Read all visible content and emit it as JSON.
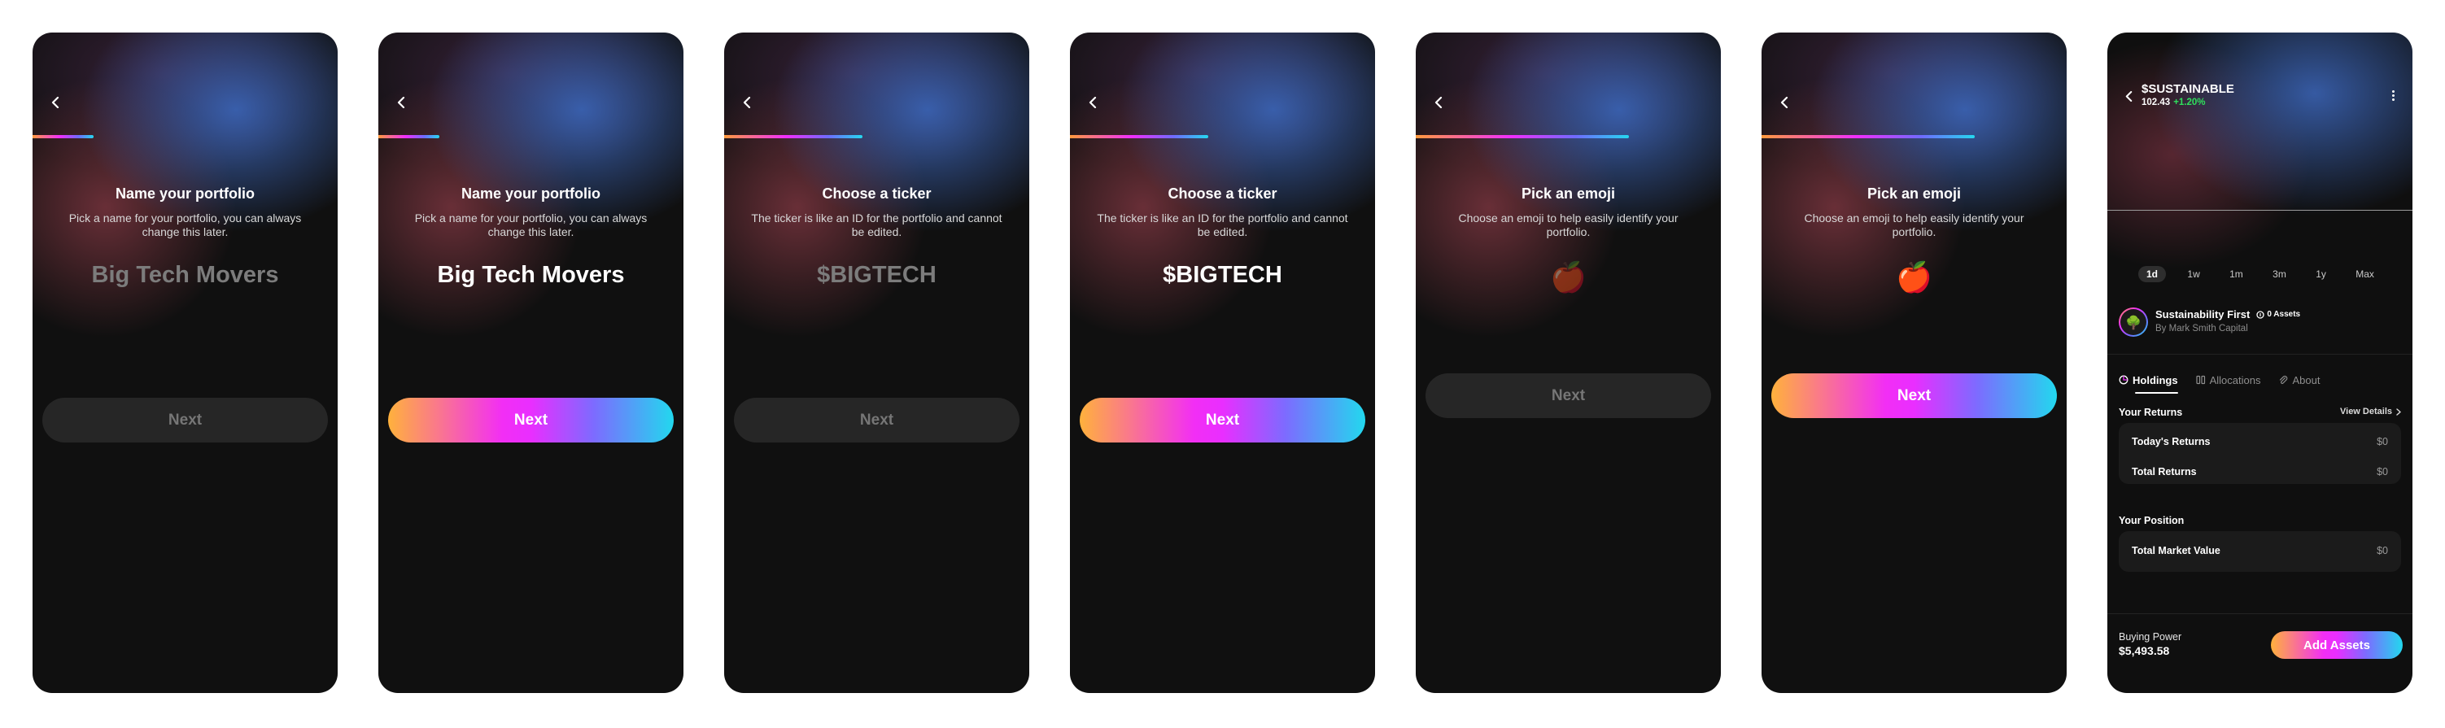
{
  "steps": [
    {
      "title": "Name your portfolio",
      "description": "Pick a name for your portfolio, you can always change this later.",
      "value": "Big Tech Movers",
      "next_label": "Next",
      "progress": 0.2
    },
    {
      "title": "Name your portfolio",
      "description": "Pick a name for your portfolio, you can always change this later.",
      "value": "Big Tech Movers",
      "next_label": "Next",
      "progress": 0.2
    },
    {
      "title": "Choose a ticker",
      "description": "The ticker is like an ID for the portfolio and cannot be edited.",
      "value": "$BIGTECH",
      "next_label": "Next",
      "progress": 0.45
    },
    {
      "title": "Choose a ticker",
      "description": "The ticker is like an ID for the portfolio and cannot be edited.",
      "value": "$BIGTECH",
      "next_label": "Next",
      "progress": 0.45
    },
    {
      "title": "Pick an emoji",
      "description": "Choose an emoji to help easily identify your portfolio.",
      "value": "🍎",
      "next_label": "Next",
      "progress": 0.7
    },
    {
      "title": "Pick an emoji",
      "description": "Choose an emoji to help easily identify your portfolio.",
      "value": "🍎",
      "next_label": "Next",
      "progress": 0.7
    }
  ],
  "portfolio": {
    "ticker": "$SUSTAINABLE",
    "price": "102.43",
    "change": "+1.20%",
    "ranges": [
      "1d",
      "1w",
      "1m",
      "3m",
      "1y",
      "Max"
    ],
    "fund_emoji": "🌳",
    "fund_name": "Sustainability First",
    "assets_count": "0 Assets",
    "fund_by": "By Mark Smith Capital",
    "tabs": [
      "Holdings",
      "Allocations",
      "About"
    ],
    "returns_title": "Your Returns",
    "view_details": "View Details",
    "returns": [
      {
        "label": "Today's Returns",
        "value": "$0"
      },
      {
        "label": "Total Returns",
        "value": "$0"
      }
    ],
    "position_title": "Your Position",
    "position": [
      {
        "label": "Total Market Value",
        "value": "$0"
      }
    ],
    "buying_power_label": "Buying Power",
    "buying_power": "$5,493.58",
    "add_assets": "Add Assets"
  },
  "colors": {
    "accent_orange": "#ffb13c",
    "accent_magenta": "#f22ef5",
    "accent_cyan": "#22d8ee",
    "positive": "#2fe05c"
  }
}
